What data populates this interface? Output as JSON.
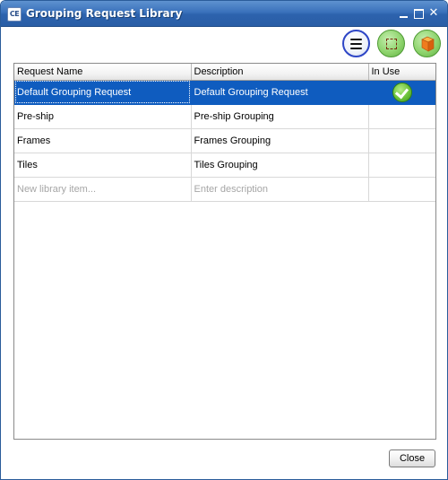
{
  "window": {
    "title": "Grouping Request Library",
    "logo_text": "CE"
  },
  "toolbar": {
    "icons": [
      "list-menu-icon",
      "dashed-selection-icon",
      "orange-cube-icon"
    ]
  },
  "table": {
    "columns": [
      "Request Name",
      "Description",
      "In Use"
    ],
    "rows": [
      {
        "name": "Default Grouping Request",
        "description": "Default Grouping Request",
        "in_use": true,
        "selected": true
      },
      {
        "name": "Pre-ship",
        "description": "Pre-ship Grouping",
        "in_use": false
      },
      {
        "name": "Frames",
        "description": "Frames Grouping",
        "in_use": false
      },
      {
        "name": "Tiles",
        "description": "Tiles Grouping",
        "in_use": false
      }
    ],
    "new_row": {
      "name_placeholder": "New library item...",
      "description_placeholder": "Enter description"
    }
  },
  "footer": {
    "close_label": "Close"
  },
  "colors": {
    "selection": "#0f5cbf",
    "titlebar": "#3a71bb",
    "check_green": "#6cc23a"
  }
}
